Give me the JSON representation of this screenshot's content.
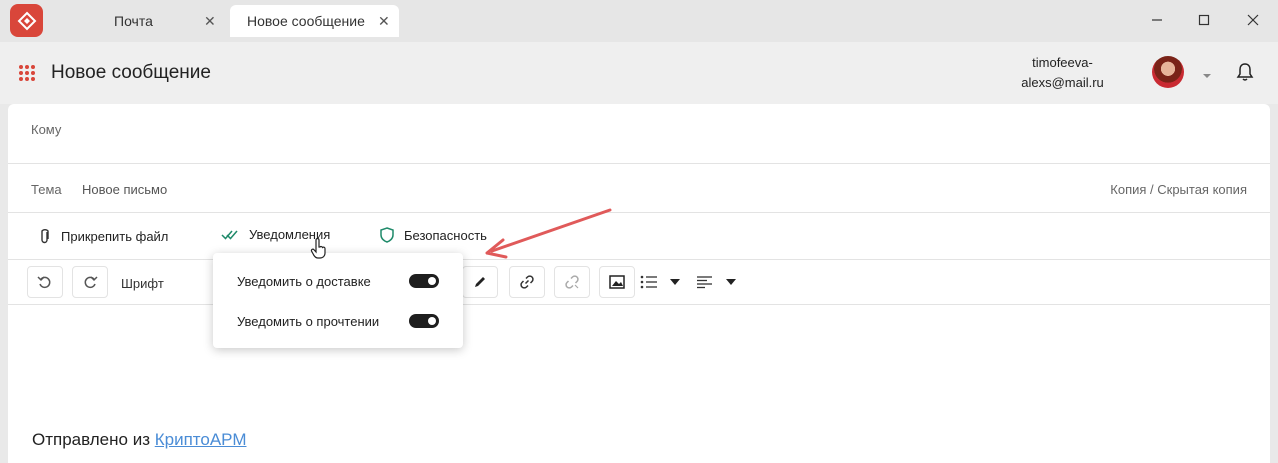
{
  "window": {
    "tabs": [
      {
        "label": "Почта",
        "active": false
      },
      {
        "label": "Новое сообщение",
        "active": true
      }
    ],
    "controls": [
      "minimize-icon",
      "maximize-icon",
      "close-icon"
    ]
  },
  "header": {
    "title": "Новое сообщение",
    "email_line1": "timofeeva-",
    "email_line2": "alexs@mail.ru"
  },
  "compose": {
    "to_label": "Кому",
    "subject_label": "Тема",
    "subject_placeholder": "Новое письмо",
    "cc_label": "Копия / Скрытая копия"
  },
  "actions": {
    "attach": "Прикрепить файл",
    "notifications": "Уведомления",
    "security": "Безопасность"
  },
  "toolbar": {
    "font_label": "Шрифт"
  },
  "popup": {
    "delivery_label": "Уведомить о доставке",
    "delivery_on": true,
    "read_label": "Уведомить о прочтении",
    "read_on": true
  },
  "signature": {
    "prefix": "Отправлено из ",
    "link": "КриптоАРМ"
  },
  "colors": {
    "logo": "#d9463a",
    "accent_green": "#1f8a6a",
    "link": "#4a8cd6",
    "annotation_arrow": "#e05a5a"
  }
}
